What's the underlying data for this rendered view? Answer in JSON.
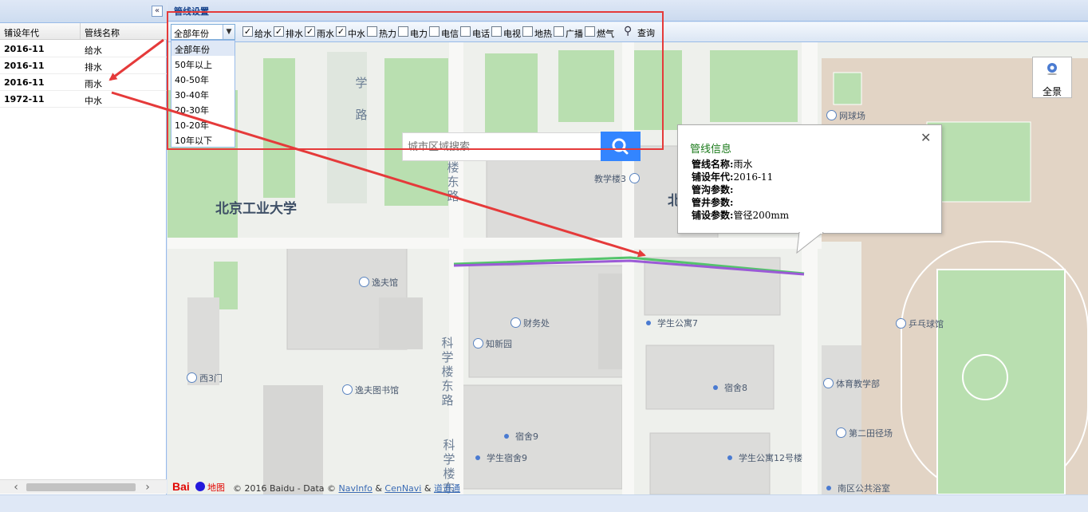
{
  "panel": {
    "title": "管线设置"
  },
  "table": {
    "headers": {
      "year": "铺设年代",
      "name": "管线名称"
    },
    "rows": [
      {
        "year": "2016-11",
        "name": "给水"
      },
      {
        "year": "2016-11",
        "name": "排水"
      },
      {
        "year": "2016-11",
        "name": "雨水"
      },
      {
        "year": "1972-11",
        "name": "中水"
      }
    ]
  },
  "toolbar": {
    "year_select_value": "全部年份",
    "checkboxes": [
      {
        "label": "给水",
        "checked": true
      },
      {
        "label": "排水",
        "checked": true
      },
      {
        "label": "雨水",
        "checked": true
      },
      {
        "label": "中水",
        "checked": true
      },
      {
        "label": "热力",
        "checked": false
      },
      {
        "label": "电力",
        "checked": false
      },
      {
        "label": "电信",
        "checked": false
      },
      {
        "label": "电话",
        "checked": false
      },
      {
        "label": "电视",
        "checked": false
      },
      {
        "label": "地热",
        "checked": false
      },
      {
        "label": "广播",
        "checked": false
      },
      {
        "label": "燃气",
        "checked": false
      }
    ],
    "query_label": "查询",
    "query_icon": "magnifier-icon"
  },
  "year_options": [
    "全部年份",
    "50年以上",
    "40-50年",
    "30-40年",
    "20-30年",
    "10-20年",
    "10年以下"
  ],
  "map": {
    "search_placeholder": "城市区域搜索",
    "overview_label": "全景",
    "labels": {
      "univ": "北京工业大学",
      "north_char": "北",
      "xue": "学",
      "lu_top": "路",
      "road1": "科学楼东路",
      "road2": "科学楼东路",
      "road3": "科学楼东",
      "tennis": "网球场",
      "jxl3": "教学楼3",
      "yifuguan": "逸夫馆",
      "caiwu": "财务处",
      "zhixinyuan": "知新园",
      "gongyu7": "学生公寓7",
      "sushe8": "宿舍8",
      "pingpang": "乒乓球馆",
      "tiyu": "体育教学部",
      "xi3men": "西3门",
      "library": "逸夫图书馆",
      "tianjing2": "第二田径场",
      "sushe9": "宿舍9",
      "xssushe9": "学生宿舍9",
      "gongyu12": "学生公寓12号楼",
      "yushi": "南区公共浴室"
    },
    "footer": {
      "copyright": "© 2016 Baidu - Data © ",
      "navinfo": "NavInfo",
      "amp1": " & ",
      "cennavi": "CenNavi",
      "amp2": " & ",
      "daodaotong": "道道通",
      "logo_text": "地图"
    }
  },
  "info_window": {
    "title": "管线信息",
    "fields": [
      {
        "key": "管线名称:",
        "value": "雨水"
      },
      {
        "key": "铺设年代:",
        "value": "2016-11"
      },
      {
        "key": "管沟参数:",
        "value": ""
      },
      {
        "key": "管井参数:",
        "value": ""
      },
      {
        "key": "铺设参数:",
        "value": "管径200mm"
      }
    ]
  },
  "colors": {
    "annotation": "#e53a3a",
    "pipe_line": "#9b5ad6",
    "pipe_line_secondary": "#53c46b",
    "search_button": "#3385ff",
    "info_title": "#1b7a1b"
  }
}
